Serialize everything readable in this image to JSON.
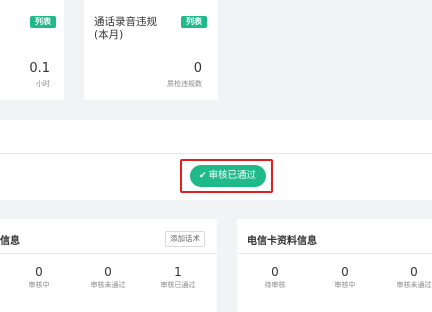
{
  "top_cards": {
    "left": {
      "badge": "列表",
      "value": "0.1",
      "unit": "小时"
    },
    "right": {
      "title_line1": "通话录音违规",
      "title_line2": "(本月)",
      "badge": "列表",
      "value": "0",
      "unit": "质检违规数"
    }
  },
  "audit": {
    "status_label": "审核已通过"
  },
  "left_panel": {
    "title": "信息",
    "add_button": "添加话术",
    "stats": [
      {
        "value": "0",
        "label": "审核中"
      },
      {
        "value": "0",
        "label": "审核未通过"
      },
      {
        "value": "1",
        "label": "审核已通过"
      }
    ]
  },
  "right_panel": {
    "title": "电信卡资料信息",
    "stats": [
      {
        "value": "0",
        "label": "待审核"
      },
      {
        "value": "0",
        "label": "审核中"
      },
      {
        "value": "0",
        "label": "审核未通过"
      }
    ]
  },
  "colors": {
    "accent": "#1fb98a",
    "highlight": "#e02020",
    "background": "#f2f3f5"
  }
}
